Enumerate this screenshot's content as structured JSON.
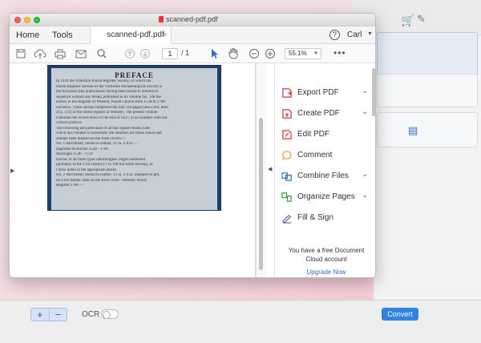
{
  "background_app": {
    "zoom_minus": "−",
    "zoom_plus": "+",
    "ocr_label": "OCR",
    "convert_label": "Convert"
  },
  "window": {
    "title": "scanned-pdf.pdf",
    "menu": {
      "home": "Home",
      "tools": "Tools"
    },
    "tab": {
      "label": "scanned-pdf.pdf",
      "close": "×"
    },
    "help": "?",
    "user": "Carl",
    "toolbar": {
      "page_current": "1",
      "page_total": "/ 1",
      "zoom": "55.1%",
      "more": "•••"
    },
    "document": {
      "title": "PREFACE",
      "lines": [
        "In 1939 the Yorkshire Parish Register Society, of which the",
        "Parish Register Section of the Yorkshire Archaeological Society is",
        "the successor (the publications having been issued in numerical",
        "sequence without any break) published as its Volume No. 108 the",
        "entries in the Register of Wensley Parish Church from 1538 to 1700",
        "inclusive. These entries comprised the first 110 pages (and a few lines",
        "of p. 111) of the oldest register at Wensley. The present volume",
        "continues the record down to the end of 1837, in accordance with our",
        "current practice.",
        "The following are particulars of all the register books with",
        "which this volume is concerned; the numbers are those which had",
        "already been marked on the front covers:—",
        "No. 1  Parchment, bound in leather, 12 in. x 8 in.—",
        "           Baptisms & Burials  1538 - 1700",
        "           Marriages              1538 - 1754",
        "           Entries of all three types intermingled. Pages numbered",
        "           (probably in the 17th century) 1 to 198 but some missing, as",
        "           I have noted in the appropriate places.",
        "No. 2  Parchment, bound in leather, 13 in. x 8 in. Stamped in gilt,",
        "           on a red leather inset on the front cover: 'Wensley Parish",
        "           Register 1700 —'"
      ]
    },
    "tools": [
      {
        "label": "Export PDF",
        "has_caret": true,
        "color": "#d7373f"
      },
      {
        "label": "Create PDF",
        "has_caret": true,
        "color": "#d7373f"
      },
      {
        "label": "Edit PDF",
        "has_caret": false,
        "color": "#d7373f"
      },
      {
        "label": "Comment",
        "has_caret": false,
        "color": "#e8a33d"
      },
      {
        "label": "Combine Files",
        "has_caret": true,
        "color": "#2d6fd0"
      },
      {
        "label": "Organize Pages",
        "has_caret": true,
        "color": "#3a9c4a"
      },
      {
        "label": "Fill & Sign",
        "has_caret": false,
        "color": "#7a55b7"
      }
    ],
    "cloud_message": "You have a free Document Cloud account",
    "upgrade_label": "Upgrade Now"
  },
  "colors": {
    "accent": "#2f83e6",
    "link": "#2d6fd0"
  }
}
